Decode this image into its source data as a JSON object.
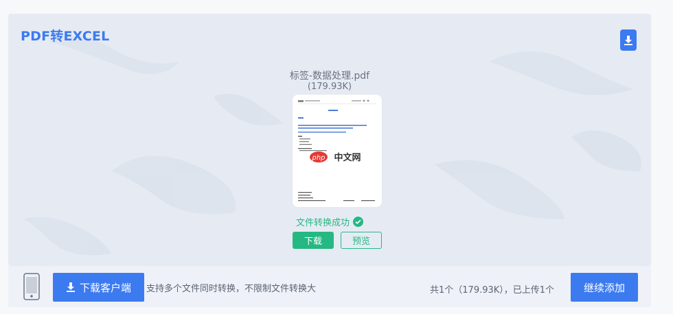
{
  "header": {
    "title": "PDF转EXCEL",
    "download_icon": "download-icon"
  },
  "file": {
    "name": "标签-数据处理.pdf",
    "size": "(179.93K)",
    "watermark": "php中文网"
  },
  "status": {
    "text": "文件转换成功",
    "icon": "check-circle-icon"
  },
  "actions": {
    "download_label": "下载",
    "preview_label": "预览"
  },
  "bottom_bar": {
    "phone_icon": "phone-icon",
    "client_button_label": "下载客户端",
    "support_text": "支持多个文件同时转换，不限制文件转换大",
    "count_text": "共1个（179.93K），已上传1个",
    "add_button_label": "继续添加"
  },
  "colors": {
    "accent": "#3c7af0",
    "success": "#25b883",
    "card_bg": "#e6ebf3"
  }
}
